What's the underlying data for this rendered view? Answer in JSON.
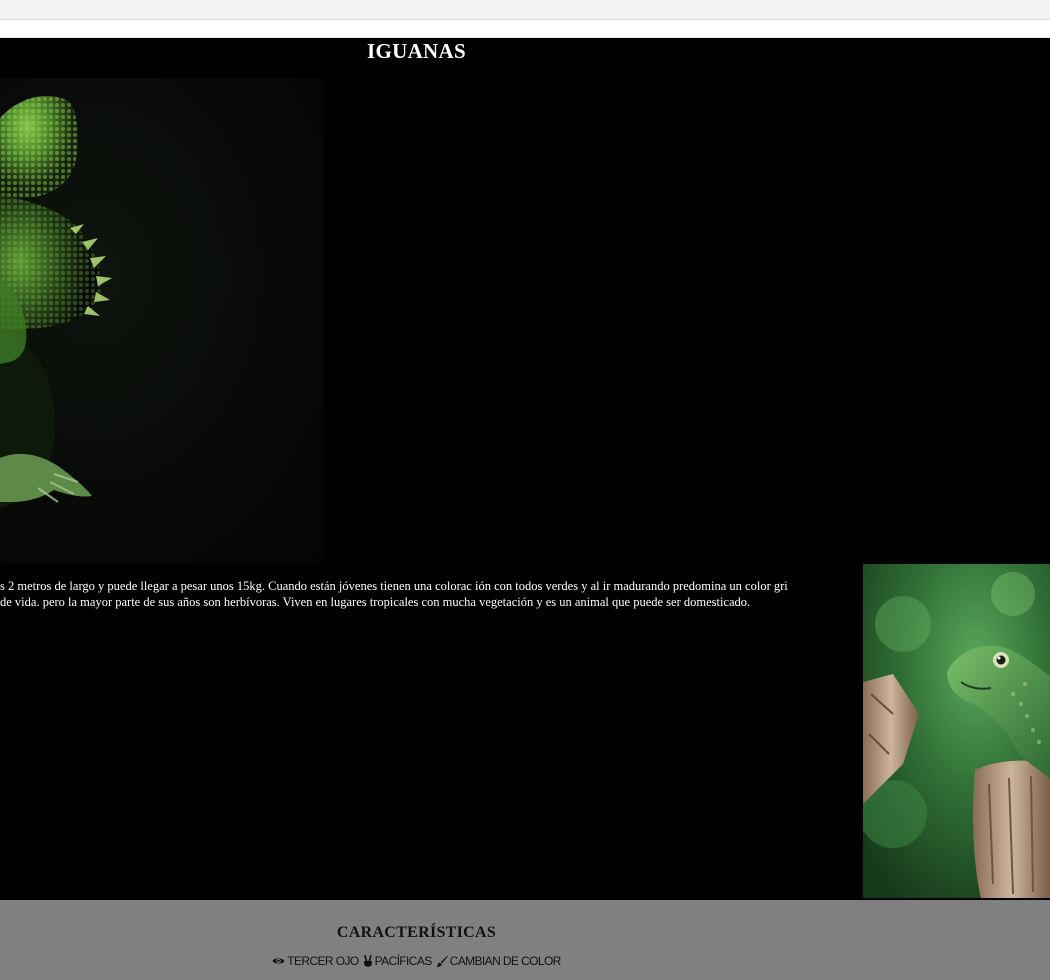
{
  "page": {
    "title": "IGUANAS",
    "body_line_1": "s 2 metros de largo y puede llegar a pesar unos 15kg. Cuando están jóvenes tienen una colorac ión con todos verdes y al ir madurando predomina un color gri",
    "body_line_2": "de vida. pero la mayor parte de sus años son herbívoras. Viven en lugares tropicales con mucha vegetación y es un animal que puede ser domesticado."
  },
  "footer": {
    "title": "CARACTERÍSTICAS",
    "features": [
      {
        "icon": "eye-icon",
        "label": "TERCER OJO"
      },
      {
        "icon": "peace-hand-icon",
        "label": "PACÍFICAS"
      },
      {
        "icon": "paint-brush-icon",
        "label": "CAMBIAN DE COLOR"
      }
    ]
  },
  "colors": {
    "page_background": "#000000",
    "footer_background": "#808080",
    "text_light": "#ffffff",
    "text_dark": "#111111"
  }
}
